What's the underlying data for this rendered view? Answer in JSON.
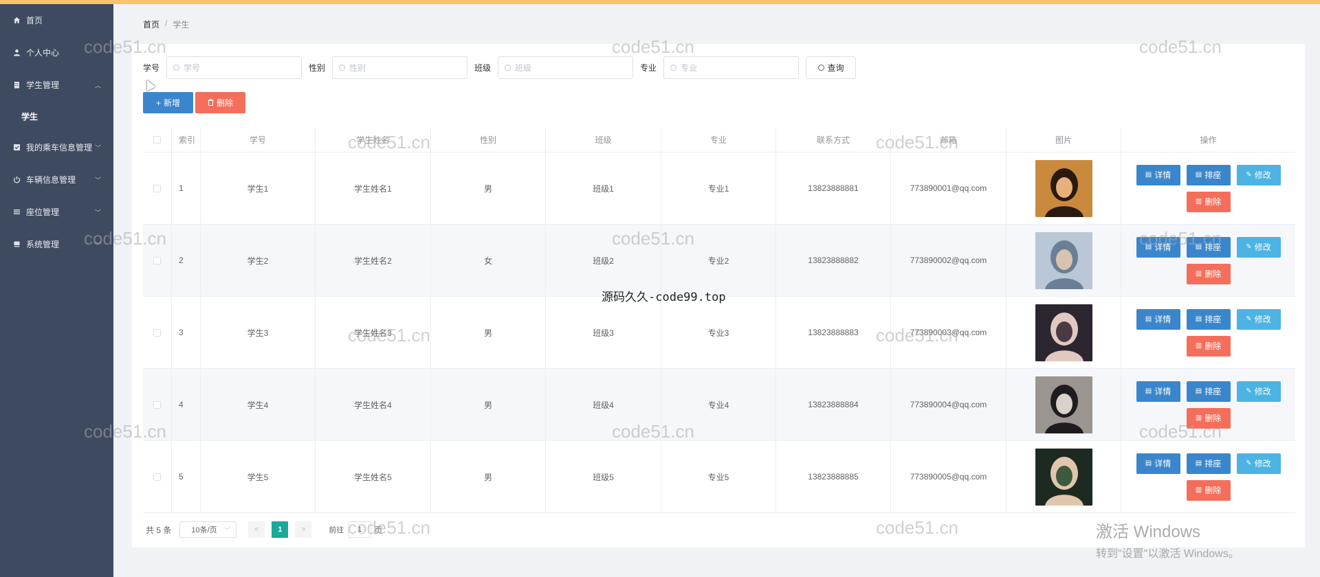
{
  "sidebar": {
    "items": [
      {
        "label": "首页",
        "icon": "home-icon"
      },
      {
        "label": "个人中心",
        "icon": "user-icon"
      },
      {
        "label": "学生管理",
        "icon": "building-icon",
        "expanded": true
      },
      {
        "label": "学生",
        "sub": true
      },
      {
        "label": "我的乘车信息管理",
        "icon": "list-icon"
      },
      {
        "label": "车辆信息管理",
        "icon": "power-icon"
      },
      {
        "label": "座位管理",
        "icon": "menu-icon"
      },
      {
        "label": "系统管理",
        "icon": "book-icon"
      }
    ]
  },
  "breadcrumb": {
    "home": "首页",
    "sep": "/",
    "current": "学生"
  },
  "search": {
    "fields": [
      {
        "label": "学号",
        "placeholder": "学号"
      },
      {
        "label": "性别",
        "placeholder": "性别"
      },
      {
        "label": "班级",
        "placeholder": "班级"
      },
      {
        "label": "专业",
        "placeholder": "专业"
      }
    ],
    "query_label": "查询"
  },
  "actions": {
    "add": "新增",
    "delete": "删除"
  },
  "table": {
    "headers": [
      "索引",
      "学号",
      "学生姓名",
      "性别",
      "班级",
      "专业",
      "联系方式",
      "邮箱",
      "图片",
      "操作"
    ],
    "ops": {
      "detail": "详情",
      "rank": "排座",
      "edit": "修改",
      "delete": "删除"
    },
    "rows": [
      {
        "idx": "1",
        "no": "学生1",
        "name": "学生姓名1",
        "sex": "男",
        "cls": "班级1",
        "major": "专业1",
        "tel": "13823888881",
        "mail": "773890001@qq.com"
      },
      {
        "idx": "2",
        "no": "学生2",
        "name": "学生姓名2",
        "sex": "女",
        "cls": "班级2",
        "major": "专业2",
        "tel": "13823888882",
        "mail": "773890002@qq.com"
      },
      {
        "idx": "3",
        "no": "学生3",
        "name": "学生姓名3",
        "sex": "男",
        "cls": "班级3",
        "major": "专业3",
        "tel": "13823888883",
        "mail": "773890003@qq.com"
      },
      {
        "idx": "4",
        "no": "学生4",
        "name": "学生姓名4",
        "sex": "男",
        "cls": "班级4",
        "major": "专业4",
        "tel": "13823888884",
        "mail": "773890004@qq.com"
      },
      {
        "idx": "5",
        "no": "学生5",
        "name": "学生姓名5",
        "sex": "男",
        "cls": "班级5",
        "major": "专业5",
        "tel": "13823888885",
        "mail": "773890005@qq.com"
      }
    ]
  },
  "pager": {
    "total": "共 5 条",
    "size": "10条/页",
    "prev": "<",
    "page": "1",
    "next": ">",
    "goto": "前往",
    "goto_value": "1",
    "goto_unit": "页"
  },
  "watermark": {
    "text": "code51.cn",
    "center": "源码久久-code99.top"
  },
  "windows_activation": {
    "line1": "激活 Windows",
    "line2": "转到\"设置\"以激活 Windows。"
  },
  "colors": {
    "sidebar": "#3e4a5f",
    "primary": "#3a86cc",
    "danger": "#f46e5b",
    "info": "#4cb3e3",
    "page_active": "#1aa99a",
    "topbar": "#f6c56b"
  }
}
